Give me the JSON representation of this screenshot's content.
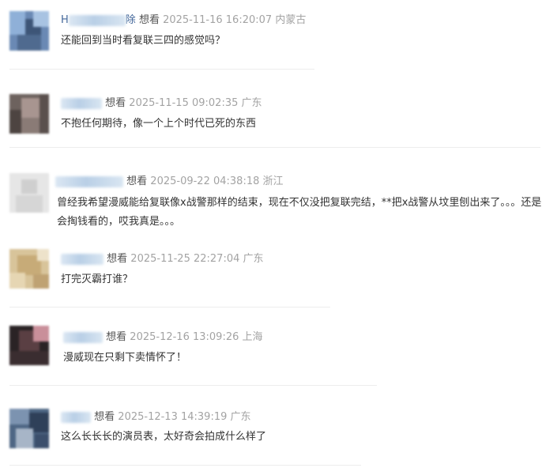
{
  "comments": [
    {
      "nickname_prefix": "H",
      "nickname_suffix": "除",
      "action": "想看",
      "timestamp": "2025-11-16 16:20:07",
      "location": "内蒙古",
      "text": "还能回到当时看复联三四的感觉吗？"
    },
    {
      "nickname_prefix": "",
      "nickname_suffix": "",
      "action": "想看",
      "timestamp": "2025-11-15 09:02:35",
      "location": "广东",
      "text": "不抱任何期待，像一个上个时代已死的东西"
    },
    {
      "nickname_prefix": "",
      "nickname_suffix": "",
      "action": "想看",
      "timestamp": "2025-09-22 04:38:18",
      "location": "浙江",
      "text": "曾经我希望漫威能给复联像x战警那样的结束，现在不仅没把复联完结，**把x战警从坟里刨出来了。。。还是会掏钱看的，哎我真是。。。"
    },
    {
      "nickname_prefix": "",
      "nickname_suffix": "",
      "action": "想看",
      "timestamp": "2025-11-25 22:27:04",
      "location": "广东",
      "text": "打完灭霸打谁？"
    },
    {
      "nickname_prefix": "",
      "nickname_suffix": "",
      "action": "想看",
      "timestamp": "2025-12-16 13:09:26",
      "location": "上海",
      "text": "漫威现在只剩下卖情怀了！"
    },
    {
      "nickname_prefix": "",
      "nickname_suffix": "",
      "action": "想看",
      "timestamp": "2025-12-13 14:39:19",
      "location": "广东",
      "text": "这么长长长的演员表，太好奇会拍成什么样了"
    }
  ],
  "colors": {
    "nickname": "#406599",
    "timestamp": "#a3a3a3",
    "body_text": "#333333",
    "divider": "#ededed"
  }
}
